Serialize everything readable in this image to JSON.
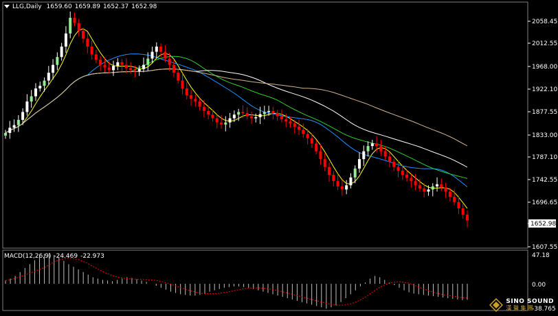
{
  "header": {
    "symbol_timeframe": "LLG,Daily",
    "open": "1659.60",
    "high": "1659.89",
    "low": "1652.37",
    "close": "1652.98"
  },
  "macd_header": {
    "label": "MACD(12,26,9)",
    "macd": "-24.469",
    "signal": "-22.973"
  },
  "price_axis": {
    "labels": [
      "2058.45",
      "2012.55",
      "1968.00",
      "1922.10",
      "1877.55",
      "1833.00",
      "1787.10",
      "1742.55",
      "1696.65",
      "1652.98",
      "1607.55"
    ],
    "current_price": "1652.98"
  },
  "macd_axis": {
    "labels": [
      "47.18",
      "0.00",
      "-38.765"
    ]
  },
  "colors": {
    "background": "#000000",
    "bull_candle": "#ffffff",
    "bear_candle": "#ff0000",
    "bull_body_alt": "#90ee90",
    "ma_fast": "#ffff00",
    "ma_blue": "#1e90ff",
    "ma_green": "#32cd32",
    "ma_white": "#ffffff",
    "ma_tan": "#d2b48c",
    "macd_hist": "#c0c0c0",
    "macd_signal": "#ff0000"
  },
  "logo": {
    "en": "SINO SOUND",
    "cn": "漢 聲 集 團"
  },
  "chart_data": {
    "type": "candlestick",
    "y_range": [
      1600,
      2070
    ],
    "close_series": [
      1820,
      1830,
      1835,
      1845,
      1860,
      1880,
      1890,
      1905,
      1910,
      1920,
      1935,
      1950,
      1965,
      1985,
      2010,
      2040,
      2030,
      2015,
      2000,
      1985,
      1970,
      1960,
      1950,
      1945,
      1940,
      1948,
      1955,
      1950,
      1944,
      1940,
      1938,
      1942,
      1950,
      1962,
      1975,
      1985,
      1975,
      1962,
      1950,
      1935,
      1920,
      1905,
      1892,
      1885,
      1880,
      1870,
      1862,
      1855,
      1848,
      1840,
      1836,
      1840,
      1848,
      1855,
      1860,
      1858,
      1852,
      1848,
      1850,
      1856,
      1860,
      1862,
      1858,
      1852,
      1846,
      1842,
      1838,
      1832,
      1826,
      1818,
      1810,
      1800,
      1785,
      1770,
      1755,
      1740,
      1728,
      1718,
      1712,
      1720,
      1735,
      1752,
      1770,
      1785,
      1795,
      1800,
      1795,
      1785,
      1775,
      1765,
      1755,
      1748,
      1740,
      1734,
      1728,
      1720,
      1714,
      1708,
      1712,
      1718,
      1722,
      1716,
      1708,
      1698,
      1688,
      1676,
      1664,
      1652.98
    ],
    "macd_range": [
      -38.765,
      47.18
    ],
    "macd_hist": [
      5,
      8,
      12,
      18,
      24,
      30,
      36,
      42,
      46,
      47,
      44,
      40,
      35,
      30,
      26,
      22,
      18,
      14,
      10,
      8,
      6,
      5,
      4,
      6,
      8,
      10,
      9,
      7,
      5,
      3,
      0,
      -3,
      -6,
      -9,
      -12,
      -14,
      -16,
      -17,
      -18,
      -18,
      -17,
      -15,
      -12,
      -10,
      -8,
      -6,
      -5,
      -4,
      -4,
      -5,
      -6,
      -8,
      -10,
      -12,
      -14,
      -16,
      -18,
      -20,
      -22,
      -24,
      -26,
      -28,
      -30,
      -32,
      -34,
      -36,
      -38,
      -36,
      -33,
      -28,
      -22,
      -16,
      -10,
      -4,
      2,
      8,
      12,
      10,
      6,
      2,
      -2,
      -6,
      -10,
      -13,
      -15,
      -16,
      -17,
      -18,
      -19,
      -20,
      -21,
      -22,
      -23,
      -24,
      -25,
      -24.469
    ]
  }
}
